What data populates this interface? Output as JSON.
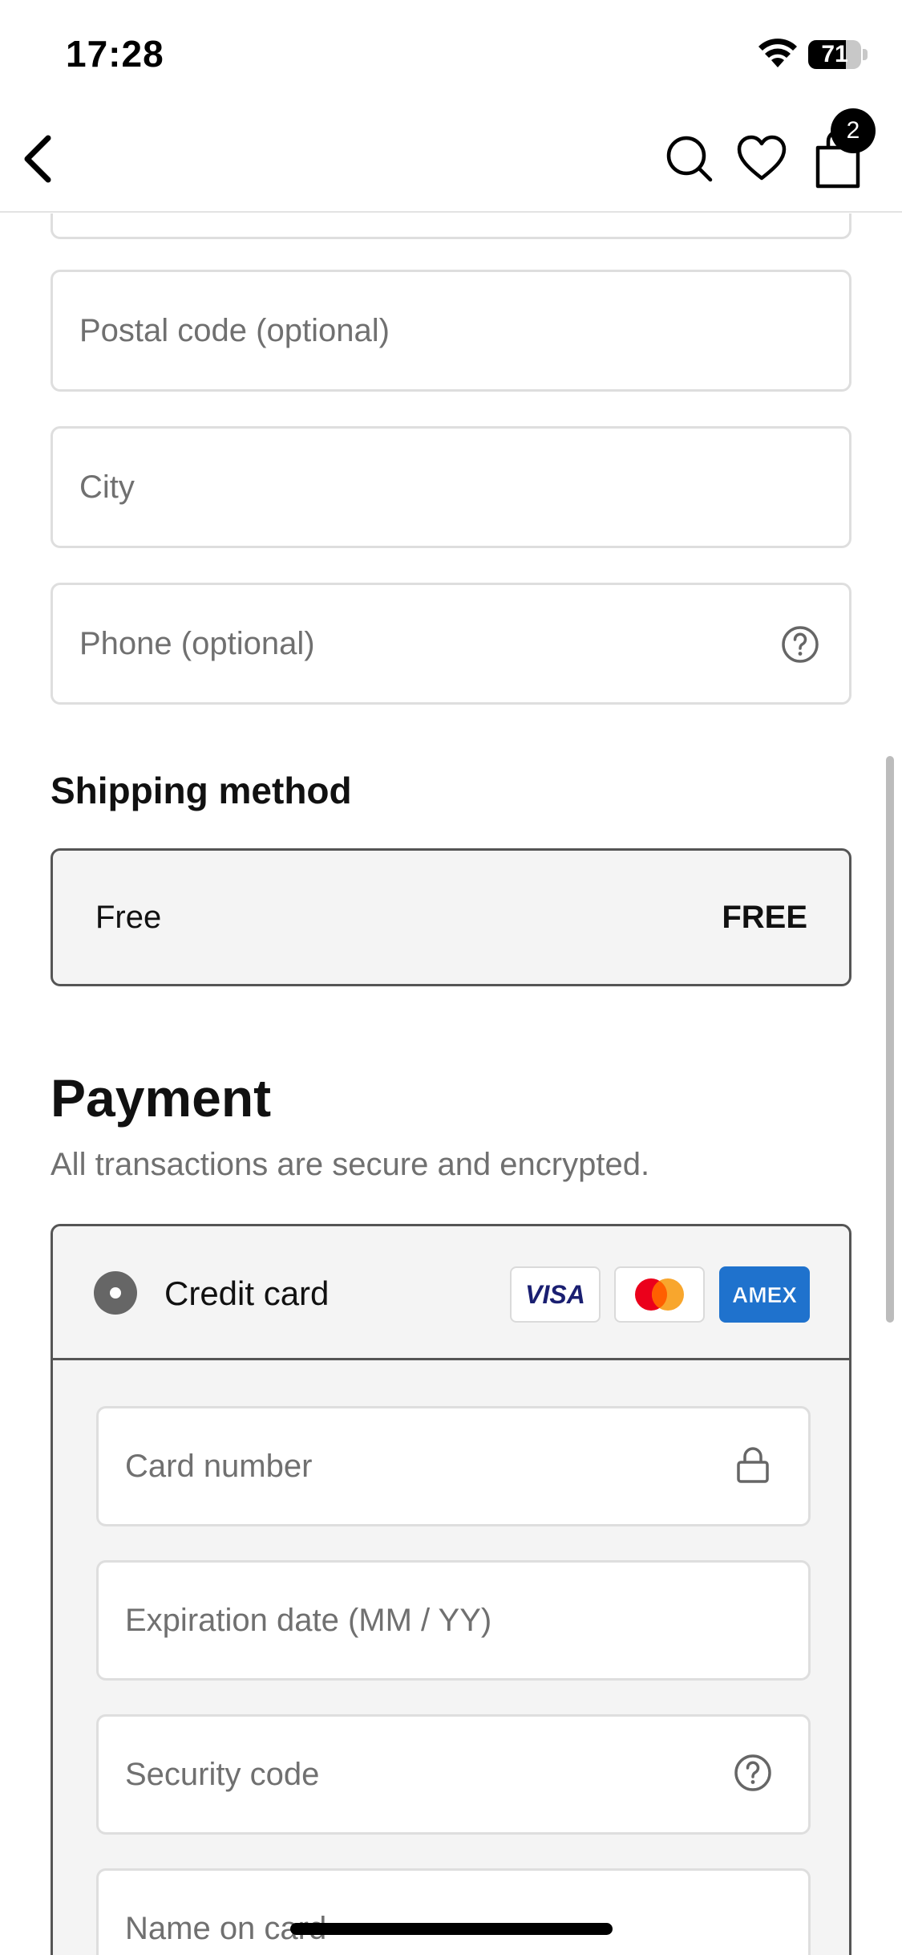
{
  "status_bar": {
    "time": "17:28",
    "battery_percent": "71",
    "battery_level": 0.71
  },
  "header": {
    "cart_count": "2"
  },
  "address_form": {
    "postal_code_placeholder": "Postal code (optional)",
    "city_placeholder": "City",
    "phone_placeholder": "Phone (optional)"
  },
  "shipping": {
    "title": "Shipping method",
    "option_name": "Free",
    "option_price": "FREE"
  },
  "payment": {
    "title": "Payment",
    "subtitle": "All transactions are secure and encrypted.",
    "method_label": "Credit card",
    "card_logos": [
      "VISA",
      "mastercard",
      "AMEX"
    ],
    "card_number_placeholder": "Card number",
    "expiration_placeholder": "Expiration date (MM / YY)",
    "security_code_placeholder": "Security code",
    "name_on_card_placeholder": "Name on card"
  },
  "colors": {
    "text": "#111111",
    "placeholder": "#707070",
    "border": "#dedede",
    "selected_border": "#555555",
    "panel_bg": "#f4f4f4",
    "amex_blue": "#1f72cd",
    "visa_blue": "#1a1f71",
    "mc_red": "#eb001b",
    "mc_orange": "#f79e1b"
  }
}
